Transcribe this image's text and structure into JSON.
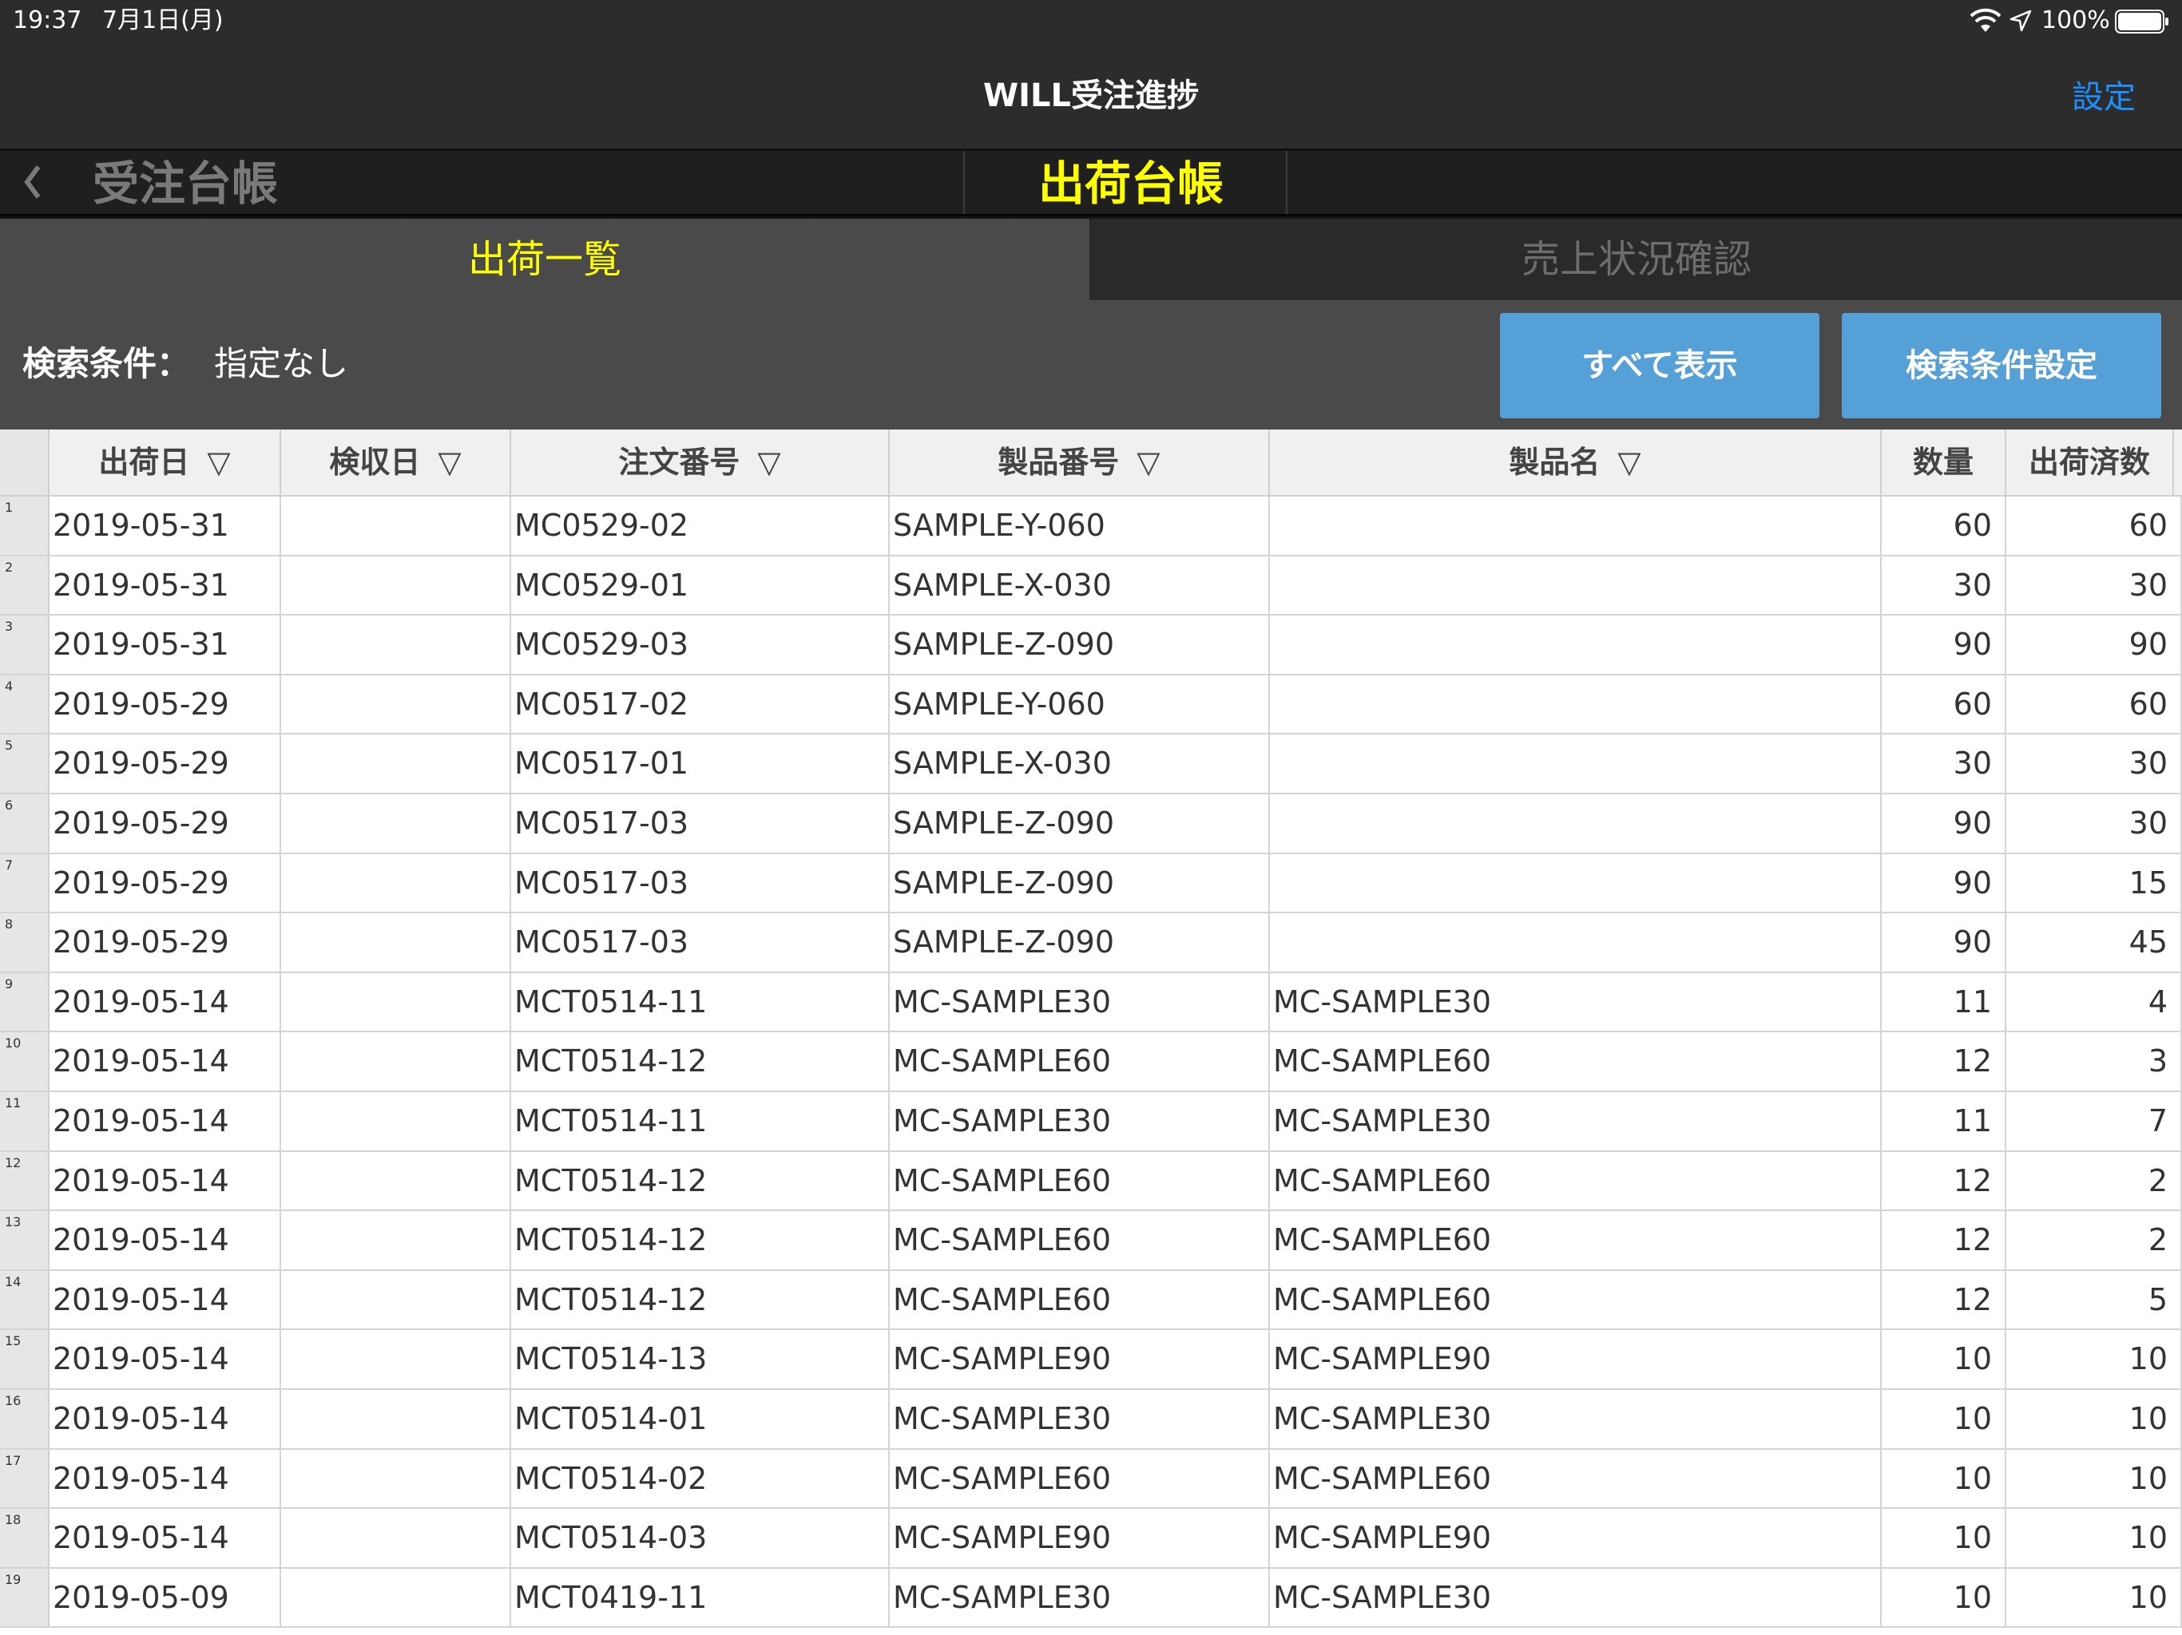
{
  "status_bar": {
    "time": "19:37",
    "date": "7月1日(月)",
    "battery": "100%"
  },
  "nav": {
    "title": "WILL受注進捗",
    "settings": "設定"
  },
  "ledger_tabs": {
    "previous": "受注台帳",
    "current": "出荷台帳"
  },
  "sub_tabs": {
    "shipments": "出荷一覧",
    "sales_status": "売上状況確認"
  },
  "search": {
    "label": "検索条件：",
    "value": "指定なし",
    "show_all": "すべて表示",
    "settings": "検索条件設定"
  },
  "sort_indicator": "▽",
  "table": {
    "columns": [
      "出荷日",
      "検収日",
      "注文番号",
      "製品番号",
      "製品名",
      "数量",
      "出荷済数"
    ],
    "rows": [
      {
        "no": "1",
        "ship_date": "2019-05-31",
        "accept_date": "",
        "order_no": "MC0529-02",
        "product_no": "SAMPLE-Y-060",
        "product_name": "",
        "qty": "60",
        "shipped": "60"
      },
      {
        "no": "2",
        "ship_date": "2019-05-31",
        "accept_date": "",
        "order_no": "MC0529-01",
        "product_no": "SAMPLE-X-030",
        "product_name": "",
        "qty": "30",
        "shipped": "30"
      },
      {
        "no": "3",
        "ship_date": "2019-05-31",
        "accept_date": "",
        "order_no": "MC0529-03",
        "product_no": "SAMPLE-Z-090",
        "product_name": "",
        "qty": "90",
        "shipped": "90"
      },
      {
        "no": "4",
        "ship_date": "2019-05-29",
        "accept_date": "",
        "order_no": "MC0517-02",
        "product_no": "SAMPLE-Y-060",
        "product_name": "",
        "qty": "60",
        "shipped": "60"
      },
      {
        "no": "5",
        "ship_date": "2019-05-29",
        "accept_date": "",
        "order_no": "MC0517-01",
        "product_no": "SAMPLE-X-030",
        "product_name": "",
        "qty": "30",
        "shipped": "30"
      },
      {
        "no": "6",
        "ship_date": "2019-05-29",
        "accept_date": "",
        "order_no": "MC0517-03",
        "product_no": "SAMPLE-Z-090",
        "product_name": "",
        "qty": "90",
        "shipped": "30"
      },
      {
        "no": "7",
        "ship_date": "2019-05-29",
        "accept_date": "",
        "order_no": "MC0517-03",
        "product_no": "SAMPLE-Z-090",
        "product_name": "",
        "qty": "90",
        "shipped": "15"
      },
      {
        "no": "8",
        "ship_date": "2019-05-29",
        "accept_date": "",
        "order_no": "MC0517-03",
        "product_no": "SAMPLE-Z-090",
        "product_name": "",
        "qty": "90",
        "shipped": "45"
      },
      {
        "no": "9",
        "ship_date": "2019-05-14",
        "accept_date": "",
        "order_no": "MCT0514-11",
        "product_no": "MC-SAMPLE30",
        "product_name": "MC-SAMPLE30",
        "qty": "11",
        "shipped": "4"
      },
      {
        "no": "10",
        "ship_date": "2019-05-14",
        "accept_date": "",
        "order_no": "MCT0514-12",
        "product_no": "MC-SAMPLE60",
        "product_name": "MC-SAMPLE60",
        "qty": "12",
        "shipped": "3"
      },
      {
        "no": "11",
        "ship_date": "2019-05-14",
        "accept_date": "",
        "order_no": "MCT0514-11",
        "product_no": "MC-SAMPLE30",
        "product_name": "MC-SAMPLE30",
        "qty": "11",
        "shipped": "7"
      },
      {
        "no": "12",
        "ship_date": "2019-05-14",
        "accept_date": "",
        "order_no": "MCT0514-12",
        "product_no": "MC-SAMPLE60",
        "product_name": "MC-SAMPLE60",
        "qty": "12",
        "shipped": "2"
      },
      {
        "no": "13",
        "ship_date": "2019-05-14",
        "accept_date": "",
        "order_no": "MCT0514-12",
        "product_no": "MC-SAMPLE60",
        "product_name": "MC-SAMPLE60",
        "qty": "12",
        "shipped": "2"
      },
      {
        "no": "14",
        "ship_date": "2019-05-14",
        "accept_date": "",
        "order_no": "MCT0514-12",
        "product_no": "MC-SAMPLE60",
        "product_name": "MC-SAMPLE60",
        "qty": "12",
        "shipped": "5"
      },
      {
        "no": "15",
        "ship_date": "2019-05-14",
        "accept_date": "",
        "order_no": "MCT0514-13",
        "product_no": "MC-SAMPLE90",
        "product_name": "MC-SAMPLE90",
        "qty": "10",
        "shipped": "10"
      },
      {
        "no": "16",
        "ship_date": "2019-05-14",
        "accept_date": "",
        "order_no": "MCT0514-01",
        "product_no": "MC-SAMPLE30",
        "product_name": "MC-SAMPLE30",
        "qty": "10",
        "shipped": "10"
      },
      {
        "no": "17",
        "ship_date": "2019-05-14",
        "accept_date": "",
        "order_no": "MCT0514-02",
        "product_no": "MC-SAMPLE60",
        "product_name": "MC-SAMPLE60",
        "qty": "10",
        "shipped": "10"
      },
      {
        "no": "18",
        "ship_date": "2019-05-14",
        "accept_date": "",
        "order_no": "MCT0514-03",
        "product_no": "MC-SAMPLE90",
        "product_name": "MC-SAMPLE90",
        "qty": "10",
        "shipped": "10"
      },
      {
        "no": "19",
        "ship_date": "2019-05-09",
        "accept_date": "",
        "order_no": "MCT0419-11",
        "product_no": "MC-SAMPLE30",
        "product_name": "MC-SAMPLE30",
        "qty": "10",
        "shipped": "10"
      }
    ]
  },
  "colors": {
    "active_tab": "#ffff00",
    "link": "#1e8fff",
    "button": "#56a0d8"
  }
}
